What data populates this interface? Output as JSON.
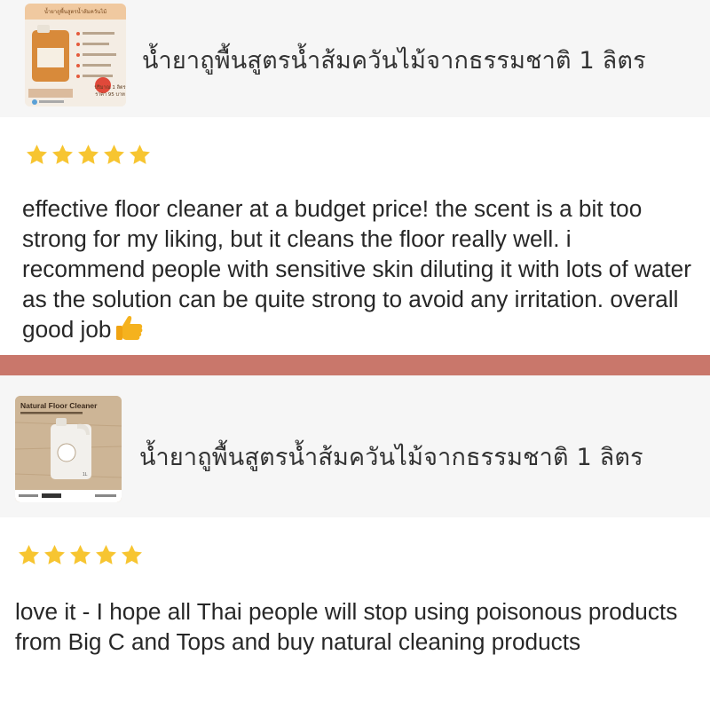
{
  "reviews": [
    {
      "product_title": "น้ำยาถูพื้นสูตรน้ำส้มควันไม้จากธรรมชาติ 1 ลิตร",
      "rating": 5,
      "text": "effective floor cleaner at a budget price! the scent is a bit too strong for my liking, but it cleans the floor really well. i recommend people with sensitive skin diluting it with lots of water as the solution can be quite strong to avoid any irritation. overall good job",
      "emoji": "thumbs-up-icon",
      "thumbnail": {
        "heading": "น้ำยาถูพื้นสูตรน้ำส้มควันไม้",
        "volume_label": "ปริมาณ 1 ลิตร",
        "price_label": "ราคา 95 บาท"
      }
    },
    {
      "product_title": "น้ำยาถูพื้นสูตรน้ำส้มควันไม้จากธรรมชาติ 1 ลิตร",
      "rating": 5,
      "text": "love it - I hope all Thai people will stop using poisonous products from Big C and Tops and buy natural cleaning products",
      "thumbnail": {
        "heading": "Natural Floor Cleaner",
        "volume_label": "1L"
      }
    }
  ],
  "colors": {
    "star": "#f7c531",
    "divider": "#c9776b",
    "strip_bg": "#f6f6f6"
  }
}
